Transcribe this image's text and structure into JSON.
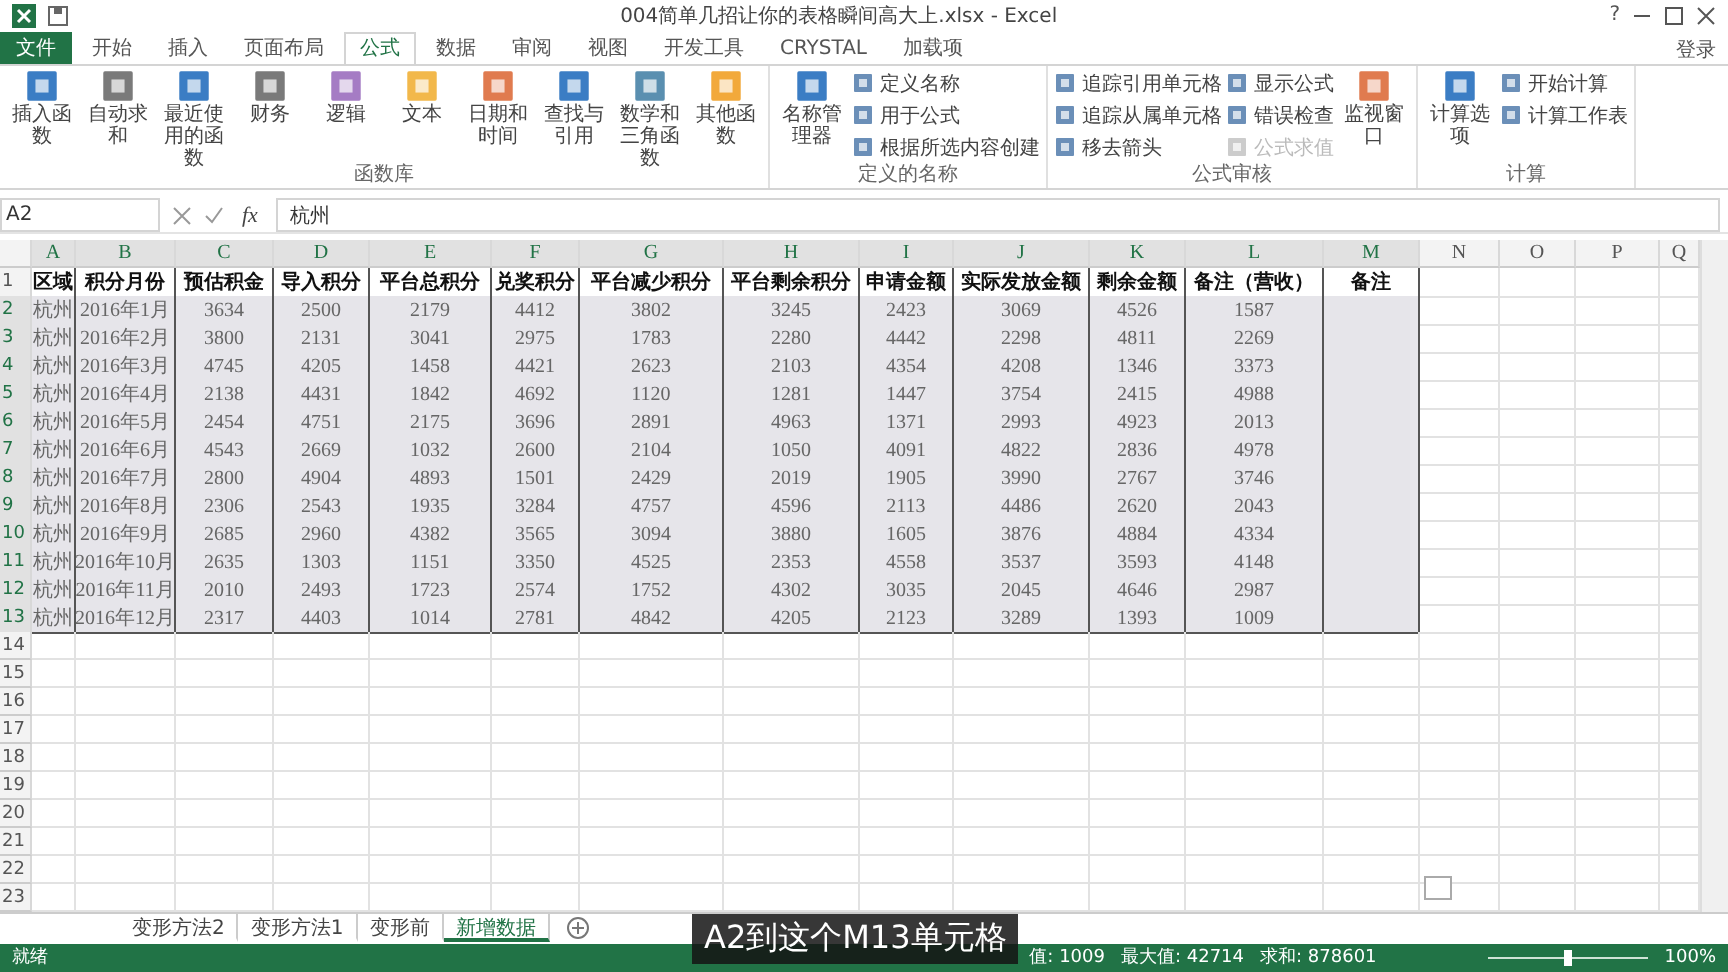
{
  "window": {
    "title": "004简单几招让你的表格瞬间高大上.xlsx - Excel",
    "help": "?",
    "sign_in": "登录"
  },
  "tabs": [
    {
      "label": "文件",
      "kind": "file",
      "selected": false
    },
    {
      "label": "开始",
      "kind": "tab",
      "selected": false
    },
    {
      "label": "插入",
      "kind": "tab",
      "selected": false
    },
    {
      "label": "页面布局",
      "kind": "tab",
      "selected": false
    },
    {
      "label": "公式",
      "kind": "tab",
      "selected": true
    },
    {
      "label": "数据",
      "kind": "tab",
      "selected": false
    },
    {
      "label": "审阅",
      "kind": "tab",
      "selected": false
    },
    {
      "label": "视图",
      "kind": "tab",
      "selected": false
    },
    {
      "label": "开发工具",
      "kind": "tab",
      "selected": false
    },
    {
      "label": "CRYSTAL",
      "kind": "tab",
      "selected": false
    },
    {
      "label": "加载项",
      "kind": "tab",
      "selected": false
    }
  ],
  "ribbon": [
    {
      "label": "函数库",
      "items": [
        {
          "label": "插入函数",
          "kind": "large",
          "disabled": false
        },
        {
          "label": "自动求和",
          "kind": "large",
          "disabled": false
        },
        {
          "label": "最近使用的函数",
          "kind": "large",
          "disabled": false
        },
        {
          "label": "财务",
          "kind": "large",
          "disabled": false
        },
        {
          "label": "逻辑",
          "kind": "large",
          "disabled": false
        },
        {
          "label": "文本",
          "kind": "large",
          "disabled": false
        },
        {
          "label": "日期和时间",
          "kind": "large",
          "disabled": false
        },
        {
          "label": "查找与引用",
          "kind": "large",
          "disabled": false
        },
        {
          "label": "数学和三角函数",
          "kind": "large",
          "disabled": false
        },
        {
          "label": "其他函数",
          "kind": "large",
          "disabled": false
        }
      ]
    },
    {
      "label": "定义的名称",
      "items": [
        {
          "label": "名称管理器",
          "kind": "large",
          "disabled": false
        },
        {
          "label": "定义名称",
          "kind": "small",
          "disabled": false
        },
        {
          "label": "用于公式",
          "kind": "small",
          "disabled": false
        },
        {
          "label": "根据所选内容创建",
          "kind": "small",
          "disabled": false
        }
      ]
    },
    {
      "label": "公式审核",
      "items": [
        {
          "label": "追踪引用单元格",
          "kind": "small",
          "disabled": false
        },
        {
          "label": "追踪从属单元格",
          "kind": "small",
          "disabled": false
        },
        {
          "label": "移去箭头",
          "kind": "small",
          "disabled": false
        },
        {
          "label": "显示公式",
          "kind": "small",
          "disabled": false
        },
        {
          "label": "错误检查",
          "kind": "small",
          "disabled": false
        },
        {
          "label": "公式求值",
          "kind": "small",
          "disabled": true
        },
        {
          "label": "监视窗口",
          "kind": "large",
          "disabled": false
        }
      ]
    },
    {
      "label": "计算",
      "items": [
        {
          "label": "计算选项",
          "kind": "large",
          "disabled": false
        },
        {
          "label": "开始计算",
          "kind": "small",
          "disabled": false
        },
        {
          "label": "计算工作表",
          "kind": "small",
          "disabled": false
        }
      ]
    }
  ],
  "formula_bar": {
    "name_box": "A2",
    "fx_label": "fx",
    "value": "杭州"
  },
  "sheet": {
    "columns": [
      "A",
      "B",
      "C",
      "D",
      "E",
      "F",
      "G",
      "H",
      "I",
      "J",
      "K",
      "L",
      "M",
      "N",
      "O",
      "P",
      "Q"
    ],
    "rows": [
      {
        "number": "1",
        "selected": false,
        "header": true,
        "cells": [
          "区域",
          "积分月份",
          "预估积金",
          "导入积分",
          "平台总积分",
          "兑奖积分",
          "平台减少积分",
          "平台剩余积分",
          "申请金额",
          "实际发放金额",
          "剩余金额",
          "备注（营收）",
          "备注"
        ]
      },
      {
        "number": "2",
        "selected": true,
        "header": false,
        "cells": [
          "杭州",
          "2016年1月",
          "3634",
          "2500",
          "2179",
          "4412",
          "3802",
          "3245",
          "2423",
          "3069",
          "4526",
          "1587"
        ]
      },
      {
        "number": "3",
        "selected": true,
        "header": false,
        "cells": [
          "杭州",
          "2016年2月",
          "3800",
          "2131",
          "3041",
          "2975",
          "1783",
          "2280",
          "4442",
          "2298",
          "4811",
          "2269"
        ]
      },
      {
        "number": "4",
        "selected": true,
        "header": false,
        "cells": [
          "杭州",
          "2016年3月",
          "4745",
          "4205",
          "1458",
          "4421",
          "2623",
          "2103",
          "4354",
          "4208",
          "1346",
          "3373"
        ]
      },
      {
        "number": "5",
        "selected": true,
        "header": false,
        "cells": [
          "杭州",
          "2016年4月",
          "2138",
          "4431",
          "1842",
          "4692",
          "1120",
          "1281",
          "1447",
          "3754",
          "2415",
          "4988"
        ]
      },
      {
        "number": "6",
        "selected": true,
        "header": false,
        "cells": [
          "杭州",
          "2016年5月",
          "2454",
          "4751",
          "2175",
          "3696",
          "2891",
          "4963",
          "1371",
          "2993",
          "4923",
          "2013"
        ]
      },
      {
        "number": "7",
        "selected": true,
        "header": false,
        "cells": [
          "杭州",
          "2016年6月",
          "4543",
          "2669",
          "1032",
          "2600",
          "2104",
          "1050",
          "4091",
          "4822",
          "2836",
          "4978"
        ]
      },
      {
        "number": "8",
        "selected": true,
        "header": false,
        "cells": [
          "杭州",
          "2016年7月",
          "2800",
          "4904",
          "4893",
          "1501",
          "2429",
          "2019",
          "1905",
          "3990",
          "2767",
          "3746"
        ]
      },
      {
        "number": "9",
        "selected": true,
        "header": false,
        "cells": [
          "杭州",
          "2016年8月",
          "2306",
          "2543",
          "1935",
          "3284",
          "4757",
          "4596",
          "2113",
          "4486",
          "2620",
          "2043"
        ]
      },
      {
        "number": "10",
        "selected": true,
        "header": false,
        "cells": [
          "杭州",
          "2016年9月",
          "2685",
          "2960",
          "4382",
          "3565",
          "3094",
          "3880",
          "1605",
          "3876",
          "4884",
          "4334"
        ]
      },
      {
        "number": "11",
        "selected": true,
        "header": false,
        "cells": [
          "杭州",
          "2016年10月",
          "2635",
          "1303",
          "1151",
          "3350",
          "4525",
          "2353",
          "4558",
          "3537",
          "3593",
          "4148"
        ]
      },
      {
        "number": "12",
        "selected": true,
        "header": false,
        "cells": [
          "杭州",
          "2016年11月",
          "2010",
          "2493",
          "1723",
          "2574",
          "1752",
          "4302",
          "3035",
          "2045",
          "4646",
          "2987"
        ]
      },
      {
        "number": "13",
        "selected": true,
        "header": false,
        "cells": [
          "杭州",
          "2016年12月",
          "2317",
          "4403",
          "1014",
          "2781",
          "4842",
          "4205",
          "2123",
          "3289",
          "1393",
          "1009"
        ]
      }
    ],
    "empty_rows": [
      "14",
      "15",
      "16",
      "17",
      "18",
      "19",
      "20",
      "21",
      "22",
      "23"
    ]
  },
  "sheet_tabs": [
    {
      "label": "变形方法2",
      "selected": false
    },
    {
      "label": "变形方法1",
      "selected": false
    },
    {
      "label": "变形前",
      "selected": false
    },
    {
      "label": "新增数据",
      "selected": true
    }
  ],
  "status_bar": {
    "ready": "就绪",
    "stats": [
      "值: 1009",
      "最大值: 42714",
      "求和: 878601"
    ],
    "zoom_slider": {
      "level": 0.5
    },
    "zoom": "100%"
  },
  "caption": "A2到这个M13单元格"
}
